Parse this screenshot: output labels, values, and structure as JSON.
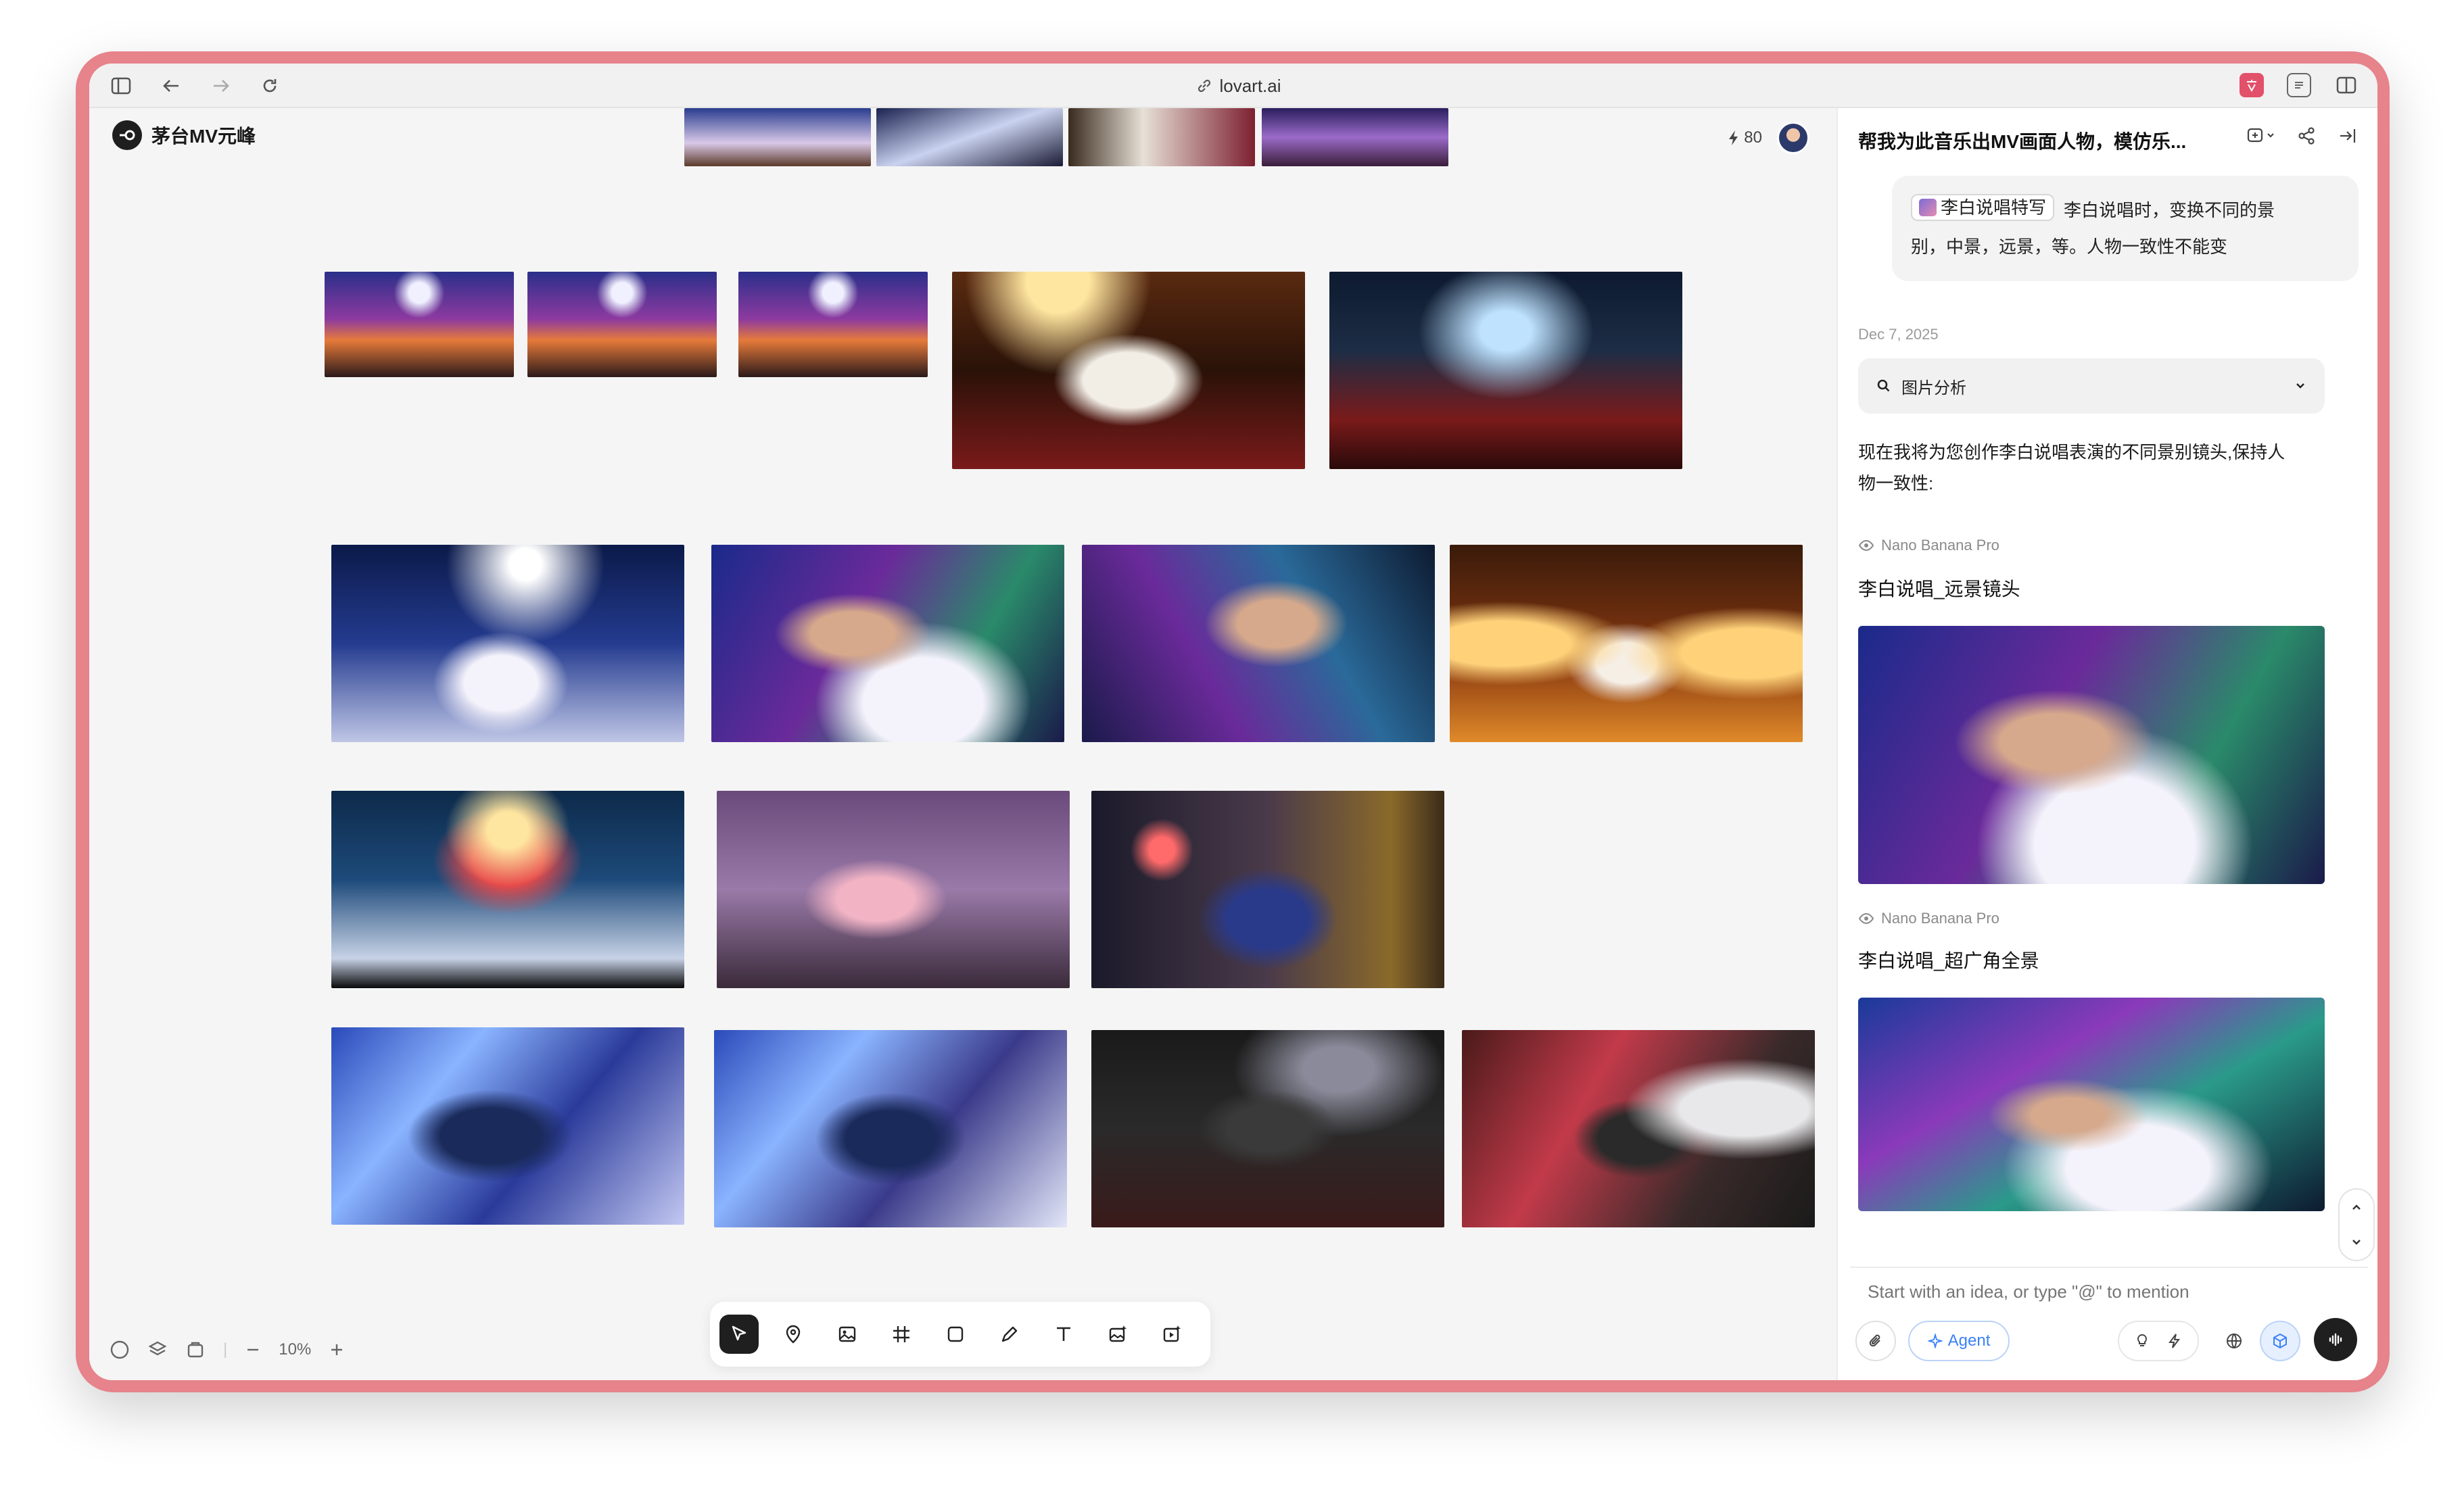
{
  "browser": {
    "url": "lovart.ai"
  },
  "app": {
    "project_name": "茅台MV元峰",
    "credits": "80"
  },
  "canvas": {
    "zoom": "10%",
    "tools": [
      "select-tool",
      "pin-tool",
      "image-tool",
      "frame-tool",
      "shape-tool",
      "pen-tool",
      "text-tool",
      "image-gen-tool",
      "video-gen-tool"
    ]
  },
  "panel": {
    "title": "帮我为此音乐出MV画面人物，模仿乐...",
    "mention_chip": "李白说唱特写",
    "prompt_line1": "李白说唱时，变换不同的景",
    "prompt_line2": "别，中景，远景，等。人物一致性不能变",
    "date": "Dec 7, 2025",
    "analysis_label": "图片分析",
    "response_line1": "现在我将为您创作李白说唱表演的不同景别镜头,保持人",
    "response_line2": "物一致性:",
    "model_name": "Nano Banana Pro",
    "gen1_title": "李白说唱_远景镜头",
    "gen2_title": "李白说唱_超广角全景",
    "input_placeholder": "Start with an idea, or type \"@\" to mention",
    "agent_label": "Agent"
  },
  "colors": {
    "frame": "#e6838b",
    "accent_blue": "#3b82f6",
    "dark": "#1f1f1f"
  }
}
